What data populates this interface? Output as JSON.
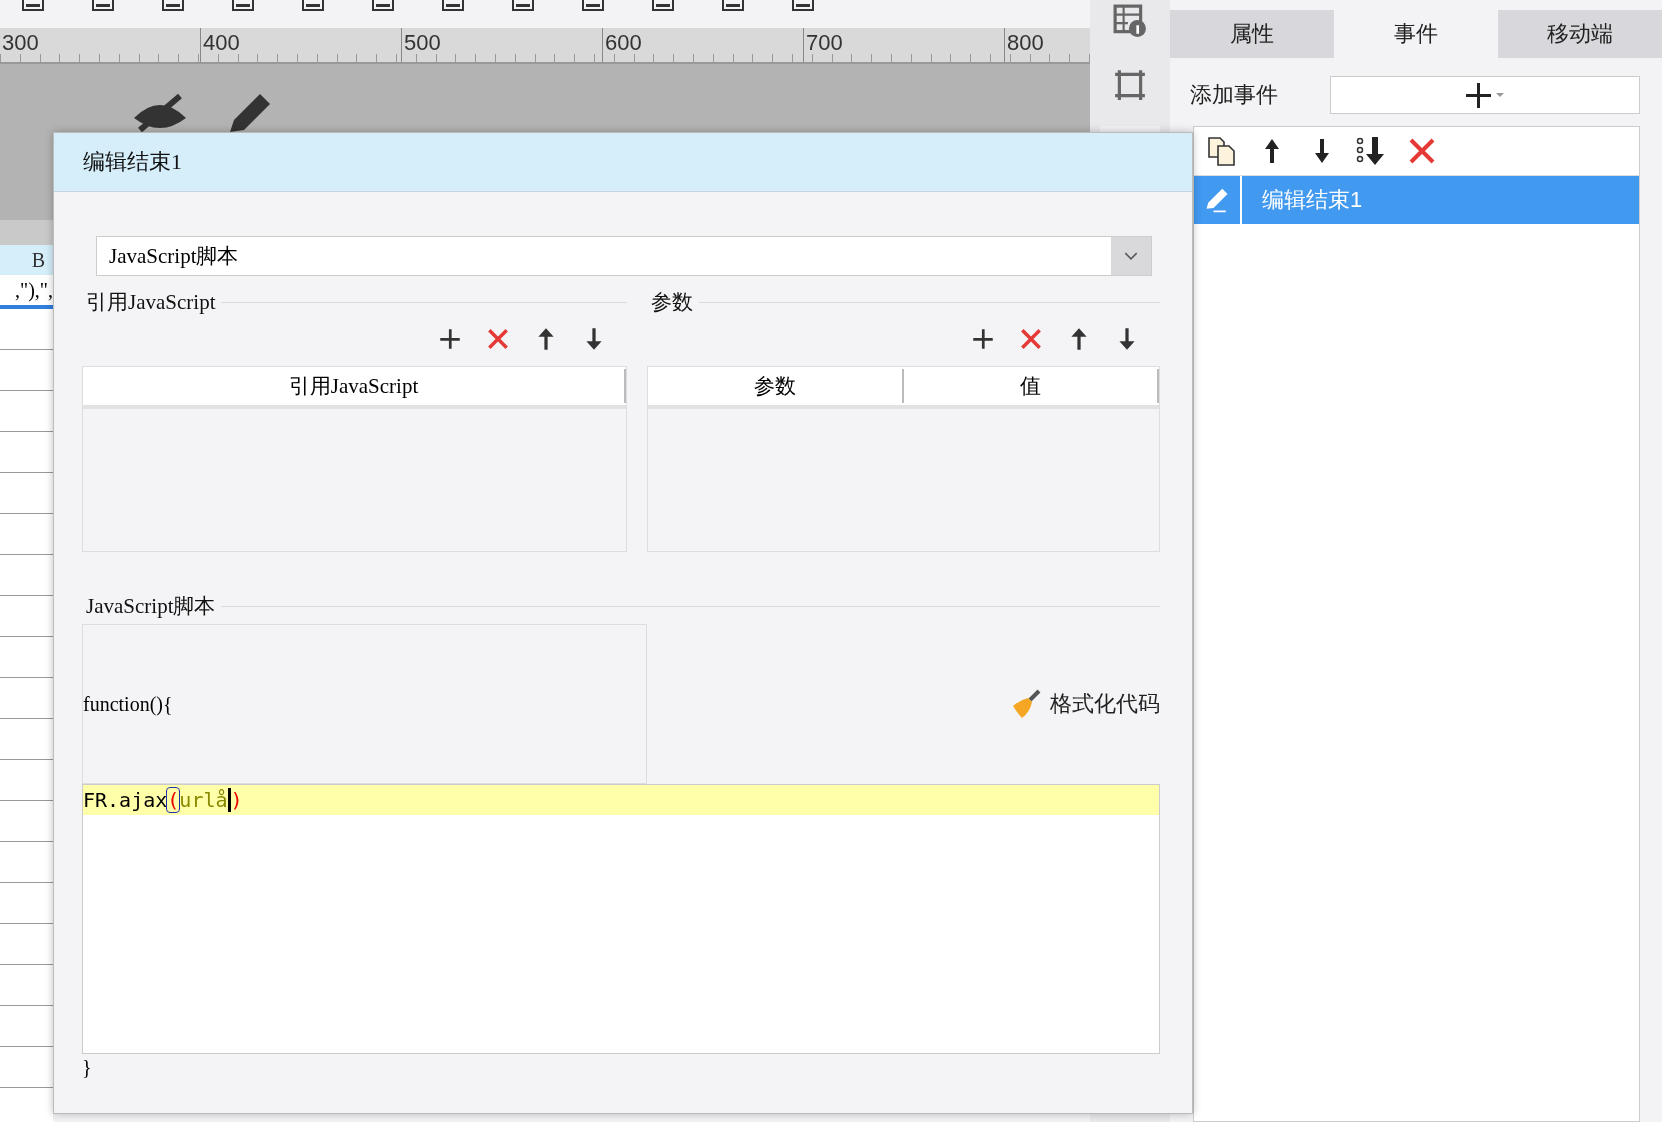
{
  "ruler": {
    "labels": [
      "300",
      "400",
      "500",
      "600",
      "700",
      "800"
    ]
  },
  "sheet": {
    "column_header": "B",
    "cell_text": ",\"),\",",
    "selected": true
  },
  "right_panel": {
    "tabs": [
      {
        "label": "属性",
        "selected": false
      },
      {
        "label": "事件",
        "selected": true
      },
      {
        "label": "移动端",
        "selected": false
      }
    ],
    "add_event_label": "添加事件",
    "events": [
      {
        "label": "编辑结束1",
        "selected": true
      }
    ]
  },
  "dialog": {
    "title": "编辑结束1",
    "type_select": {
      "value": "JavaScript脚本"
    },
    "ref_section": {
      "title": "引用JavaScript",
      "columns": [
        "引用JavaScript"
      ]
    },
    "param_section": {
      "title": "参数",
      "columns": [
        "参数",
        "值"
      ]
    },
    "script_section": {
      "title": "JavaScript脚本",
      "header_line": "function(){",
      "format_button": "格式化代码",
      "lines": [
        {
          "highlighted": true,
          "tokens": [
            {
              "kind": "plain",
              "text": "FR.ajax"
            },
            {
              "kind": "matched-bracket",
              "text": "("
            },
            {
              "kind": "identifier",
              "text": "urlå"
            },
            {
              "kind": "cursor"
            },
            {
              "kind": "bracket",
              "text": ")"
            }
          ]
        }
      ],
      "footer_line": "}"
    }
  }
}
